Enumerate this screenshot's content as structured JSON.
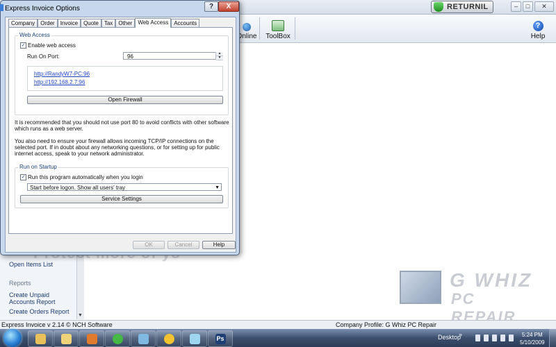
{
  "app": {
    "returnil_label": "RETURNIL",
    "toolbar": {
      "online_label": "Online",
      "toolbox_label": "ToolBox",
      "help_label": "Help"
    },
    "sidebar": {
      "items": [
        "Open Items List",
        "Reports",
        "Create Unpaid Accounts Report",
        "Create Orders Report"
      ]
    },
    "watermark": "Protect more of yo",
    "status_left": "Express Invoice v 2.14 © NCH Software",
    "status_right": "Company Profile: G Whiz PC Repair"
  },
  "logo": {
    "line1": "G WHIZ",
    "line2": "PC REPAIR"
  },
  "taskbar": {
    "desktop_label": "Desktop",
    "chevron": "»",
    "time": "5:24 PM",
    "date": "5/10/2009",
    "apps": [
      "folder-icon",
      "firefox-icon",
      "explorer-icon",
      "media-icon",
      "green-app-icon",
      "network-icon",
      "yahoo-icon",
      "notepad-icon",
      "photoshop-icon"
    ],
    "photoshop_label": "Ps"
  },
  "dialog": {
    "title": "Express Invoice Options",
    "help_btn": "?",
    "close_btn": "X",
    "tabs": [
      "Company",
      "Order",
      "Invoice",
      "Quote",
      "Tax",
      "Other",
      "Web Access",
      "Accounts"
    ],
    "active_tab": "Web Access",
    "web_access": {
      "group_label": "Web Access",
      "enable_label": "Enable web access",
      "enable_checked": "✓",
      "port_label": "Run On Port:",
      "port_value": "96",
      "urls": [
        "http://RandyW7-PC:96",
        "http://192.168.2.7:96"
      ],
      "open_firewall": "Open Firewall"
    },
    "note1": "It is recommended that you should not use port 80 to avoid conflicts with other software which runs as a web server.",
    "note2": "You also need to ensure your firewall allows incoming TCP/IP connections on the selected port. If in doubt about any networking questions, or for setting up for public internet access, speak to your network administrator.",
    "startup": {
      "group_label": "Run on Startup",
      "auto_label": "Run this program automatically when you login",
      "auto_checked": "✓",
      "select_value": "Start before logon. Show all users' tray",
      "service_settings": "Service Settings"
    },
    "buttons": {
      "ok": "OK",
      "cancel": "Cancel",
      "help": "Help"
    }
  }
}
